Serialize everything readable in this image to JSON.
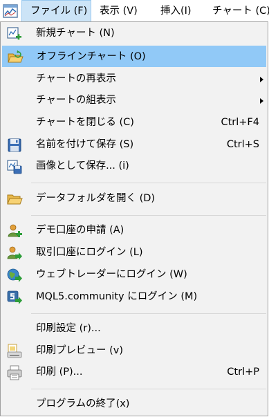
{
  "menubar": {
    "items": [
      {
        "label": "ファイル (F)"
      },
      {
        "label": "表示 (V)"
      },
      {
        "label": "挿入(I)"
      },
      {
        "label": "チャート (C)"
      }
    ]
  },
  "file_menu": {
    "new_chart": "新規チャート (N)",
    "offline_chart": "オフラインチャート (O)",
    "chart_redisplay": "チャートの再表示",
    "chart_arrange": "チャートの組表示",
    "close_chart": "チャートを閉じる (C)",
    "close_chart_shortcut": "Ctrl+F4",
    "save_as": "名前を付けて保存 (S)",
    "save_as_shortcut": "Ctrl+S",
    "save_as_image": "画像として保存... (i)",
    "open_data_folder": "データフォルダを開く (D)",
    "demo_account": "デモ口座の申請 (A)",
    "login_trade": "取引口座にログイン (L)",
    "login_webtrader": "ウェブトレーダーにログイン (W)",
    "login_mql5": "MQL5.community にログイン (M)",
    "print_setup": "印刷設定 (r)...",
    "print_preview": "印刷プレビュー (v)",
    "print": "印刷 (P)...",
    "print_shortcut": "Ctrl+P",
    "exit": "プログラムの終了(x)"
  },
  "colors": {
    "menu_bg": "#f2f2f2",
    "highlight": "#91c9f7",
    "active_top": "#cce4f7"
  },
  "icons": {
    "app": "chart-window-icon",
    "new_chart": "new-chart-icon",
    "offline_chart": "folder-refresh-icon",
    "save": "floppy-disk-icon",
    "save_image": "save-image-icon",
    "folder": "folder-icon",
    "demo": "user-add-icon",
    "login": "user-login-icon",
    "web": "globe-login-icon",
    "mql5": "mql5-login-icon",
    "print_preview": "print-preview-icon",
    "print": "printer-icon"
  }
}
